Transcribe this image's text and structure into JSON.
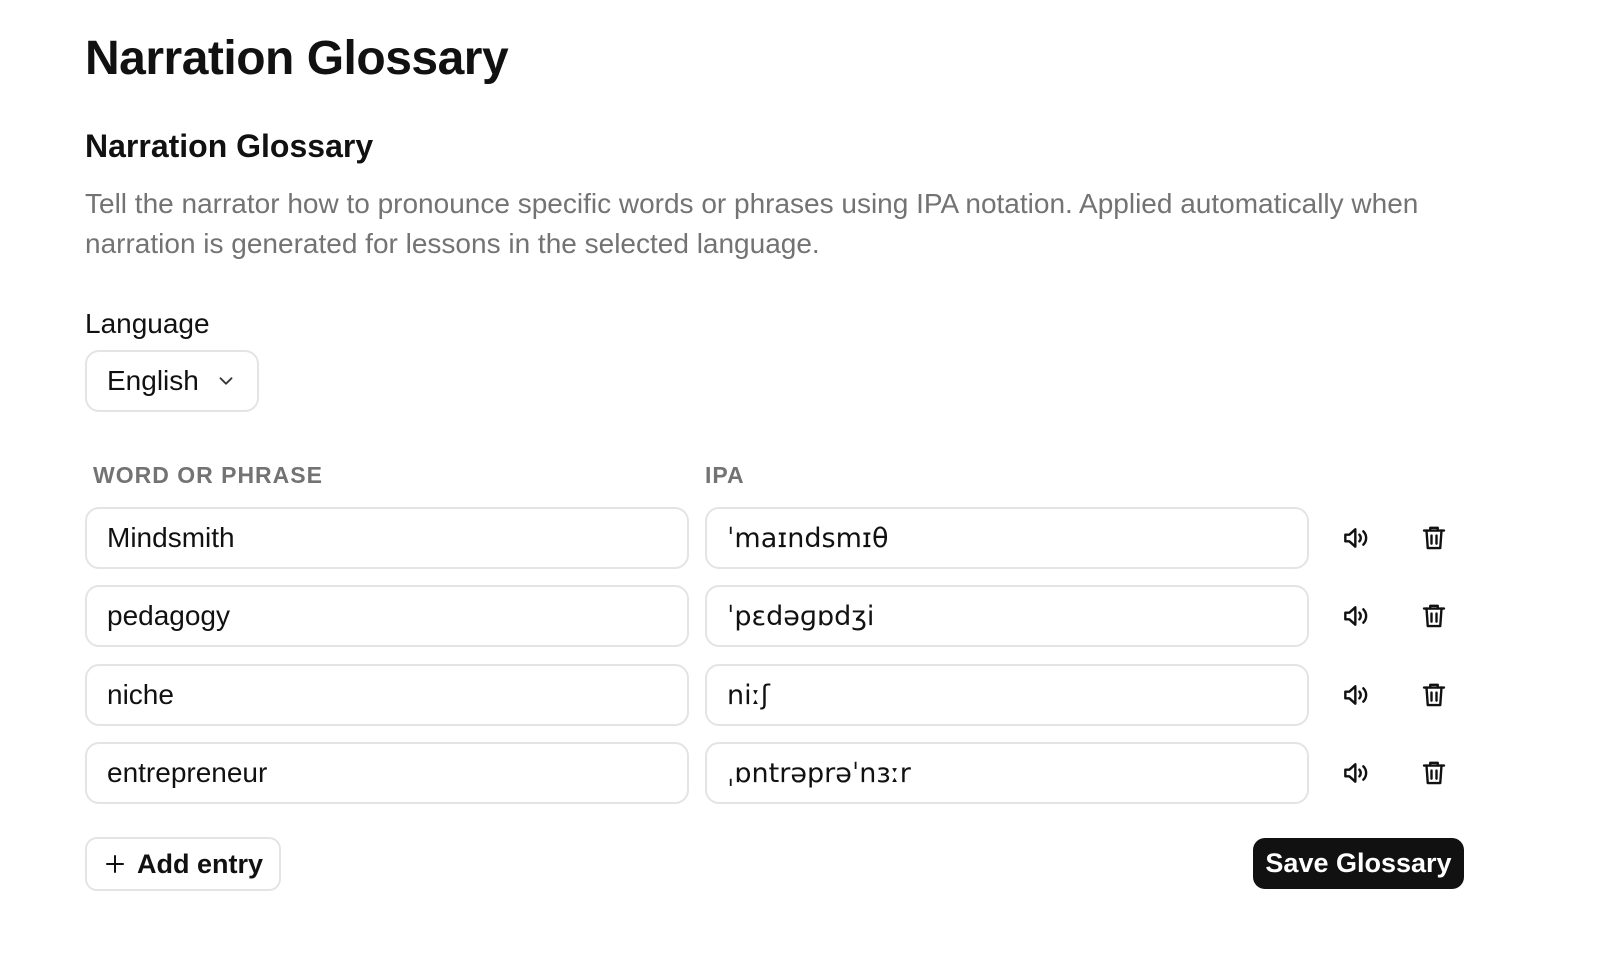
{
  "page": {
    "title": "Narration Glossary"
  },
  "section": {
    "title": "Narration Glossary",
    "description": "Tell the narrator how to pronounce specific words or phrases using IPA notation. Applied automatically when narration is generated for lessons in the selected language."
  },
  "language": {
    "label": "Language",
    "selected": "English",
    "icon": "chevron-down-icon"
  },
  "table": {
    "headers": {
      "word": "WORD OR PHRASE",
      "ipa": "IPA"
    },
    "rows": [
      {
        "word": "Mindsmith",
        "ipa": "ˈmaɪndsmɪθ"
      },
      {
        "word": "pedagogy",
        "ipa": "ˈpɛdəɡɒdʒi"
      },
      {
        "word": "niche",
        "ipa": "niːʃ"
      },
      {
        "word": "entrepreneur",
        "ipa": "ˌɒntrəprəˈnɜːr"
      }
    ],
    "row_icons": [
      "speaker-icon",
      "trash-icon"
    ]
  },
  "actions": {
    "add_label": "Add entry",
    "add_icon": "plus-icon",
    "save_label": "Save Glossary"
  },
  "colors": {
    "text": "#111111",
    "muted": "#737373",
    "border": "#e4e4e4",
    "primary_button": "#111111"
  }
}
